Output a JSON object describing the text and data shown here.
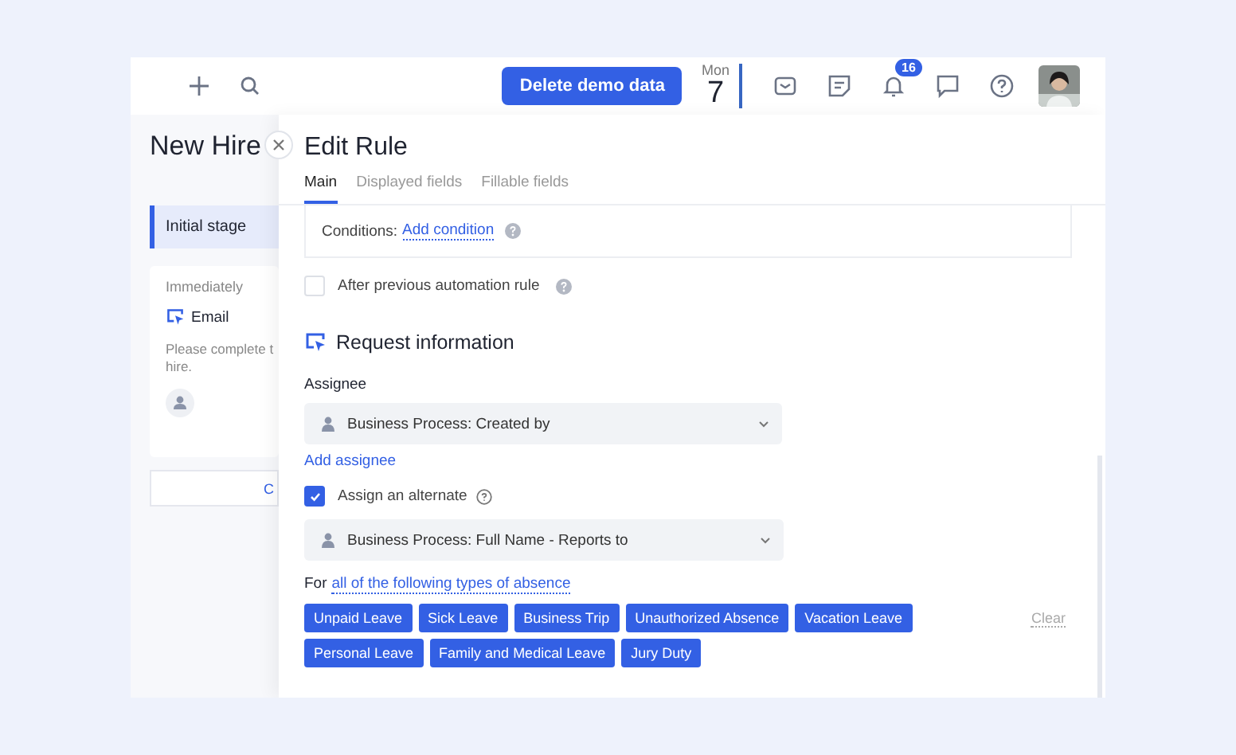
{
  "header": {
    "demo_button": "Delete demo data",
    "date": {
      "weekday": "Mon",
      "day": "7"
    },
    "notifications_badge": "16"
  },
  "background_page": {
    "title": "New Hire",
    "stage": "Initial stage",
    "step": {
      "timing": "Immediately",
      "type": "Email",
      "text": "Please complete t",
      "text_line2": "hire."
    },
    "button": "C"
  },
  "drawer": {
    "title": "Edit Rule",
    "tabs": [
      {
        "label": "Main",
        "selected": true
      },
      {
        "label": "Displayed fields",
        "selected": false
      },
      {
        "label": "Fillable fields",
        "selected": false
      }
    ],
    "conditions": {
      "label": "Conditions:",
      "link": "Add condition"
    },
    "after_previous": {
      "label": "After previous automation rule",
      "checked": false
    },
    "section": {
      "title": "Request information",
      "assignee_label": "Assignee",
      "assignee_value": "Business Process: Created by",
      "add_assignee": "Add assignee",
      "alternate": {
        "label": "Assign an alternate",
        "checked": true,
        "value": "Business Process: Full Name - Reports to"
      },
      "absence": {
        "prefix": "For",
        "link": "all of the following types of absence",
        "clear": "Clear",
        "tags": [
          "Unpaid Leave",
          "Sick Leave",
          "Business Trip",
          "Unauthorized Absence",
          "Vacation Leave",
          "Personal Leave",
          "Family and Medical Leave",
          "Jury Duty"
        ]
      }
    }
  }
}
